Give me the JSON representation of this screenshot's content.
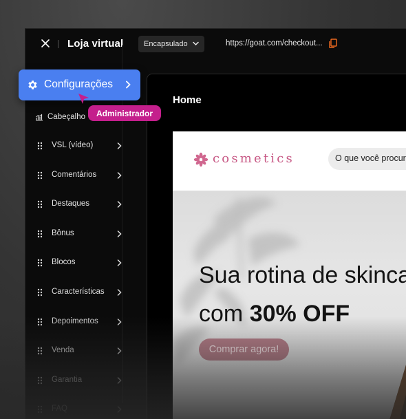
{
  "topbar": {
    "title": "Loja virtual",
    "mode": "Encapsulado",
    "url": "https://goat.com/checkout..."
  },
  "config_button": {
    "label": "Configurações"
  },
  "user_tag": "Administrador",
  "sidebar": {
    "header_item": "Cabeçalho",
    "items": [
      {
        "label": "VSL (vídeo)"
      },
      {
        "label": "Comentários"
      },
      {
        "label": "Destaques"
      },
      {
        "label": "Bônus"
      },
      {
        "label": "Blocos"
      },
      {
        "label": "Características"
      },
      {
        "label": "Depoimentos"
      },
      {
        "label": "Venda"
      },
      {
        "label": "Garantia"
      },
      {
        "label": "FAQ"
      }
    ]
  },
  "preview": {
    "page_title": "Home",
    "brand": "cosmetics",
    "search_placeholder": "O que você procura?",
    "hero_line1": "Sua rotina de skincare",
    "hero_line2_prefix": "com ",
    "hero_line2_bold": "30% OFF",
    "cta_label": "Comprar agora!"
  },
  "colors": {
    "accent": "#4a7ff0",
    "tag": "#c41f8c",
    "brand": "#c85a86",
    "cta": "#b57c87"
  }
}
